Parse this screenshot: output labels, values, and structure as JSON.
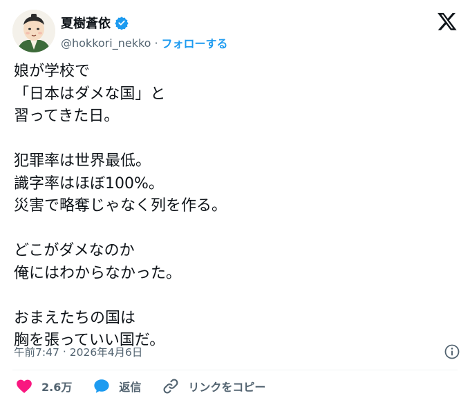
{
  "author": {
    "display_name": "夏樹蒼依",
    "handle": "@hokkori_nekko",
    "separator": "·",
    "follow_label": "フォローする",
    "verified": true,
    "verified_color": "#1d9bf0"
  },
  "tweet": {
    "lines": [
      "娘が学校で",
      "「日本はダメな国」と",
      "習ってきた日。",
      "",
      "犯罪率は世界最低。",
      "識字率はほぼ100%。",
      "災害で略奪じゃなく列を作る。",
      "",
      "どこがダメなのか",
      "俺にはわからなかった。",
      "",
      "おまえたちの国は",
      "胸を張っていい国だ。"
    ],
    "time": "午前7:47",
    "time_separator": "·",
    "date": "2026年4月6日"
  },
  "actions": {
    "like_count": "2.6万",
    "reply_label": "返信",
    "copy_link_label": "リンクをコピー"
  },
  "colors": {
    "text": "#0f1419",
    "secondary": "#536471",
    "accent": "#1d9bf0",
    "like": "#f91880"
  },
  "icons": {
    "logo": "x-logo-icon",
    "verified": "verified-badge-icon",
    "info": "info-icon",
    "like": "heart-icon",
    "reply": "speech-bubble-icon",
    "link": "link-icon"
  }
}
